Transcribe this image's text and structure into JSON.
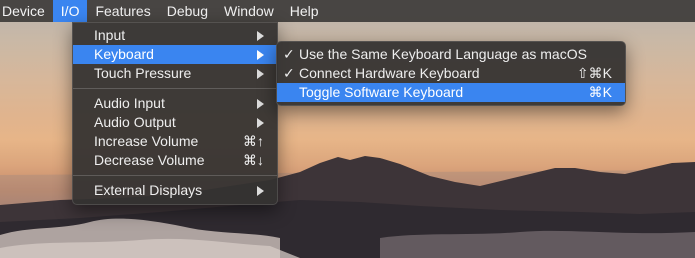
{
  "menubar": {
    "items": [
      {
        "label": "Device"
      },
      {
        "label": "I/O"
      },
      {
        "label": "Features"
      },
      {
        "label": "Debug"
      },
      {
        "label": "Window"
      },
      {
        "label": "Help"
      }
    ]
  },
  "io_menu": {
    "input": "Input",
    "keyboard": "Keyboard",
    "touch_pressure": "Touch Pressure",
    "audio_input": "Audio Input",
    "audio_output": "Audio Output",
    "increase_volume": "Increase Volume",
    "increase_volume_shortcut": "⌘↑",
    "decrease_volume": "Decrease Volume",
    "decrease_volume_shortcut": "⌘↓",
    "external_displays": "External Displays"
  },
  "keyboard_menu": {
    "same_language": "Use the Same Keyboard Language as macOS",
    "same_language_check": "✓",
    "connect_hardware": "Connect Hardware Keyboard",
    "connect_hardware_check": "✓",
    "connect_hardware_shortcut": "⇧⌘K",
    "toggle_software": "Toggle Software Keyboard",
    "toggle_software_shortcut": "⌘K"
  },
  "colors": {
    "highlight": "#3a85f0",
    "menu_background": "#343231",
    "menubar_background": "#3e3c3a"
  }
}
